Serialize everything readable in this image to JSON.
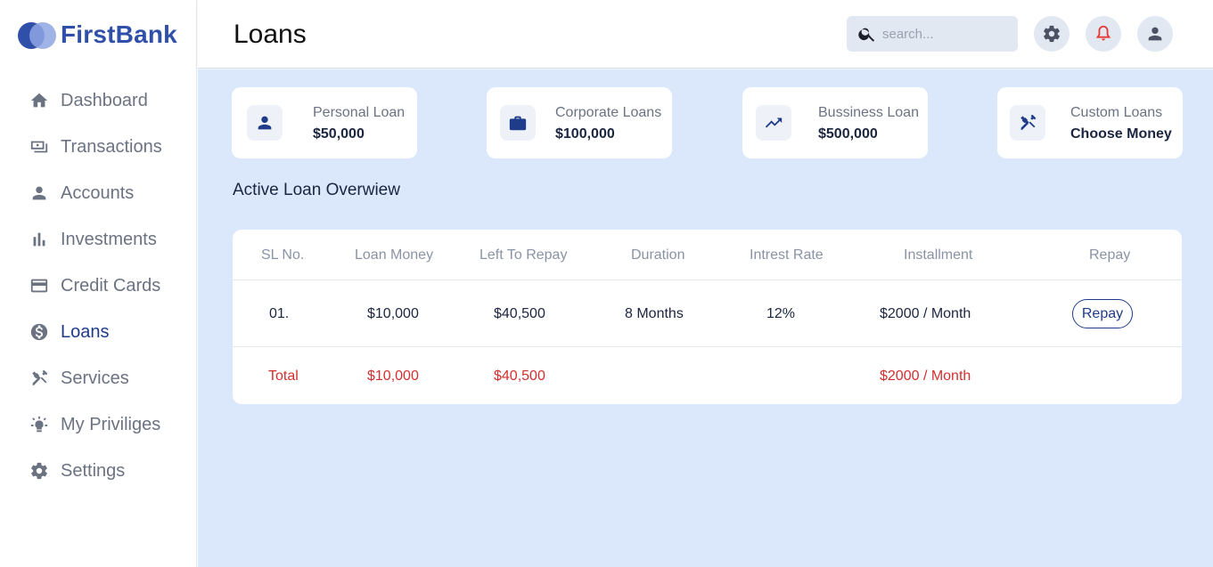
{
  "brand": {
    "name": "FirstBank",
    "primary": "#2f4fa9",
    "accent": "#8fa6e3"
  },
  "sidebar": {
    "items": [
      {
        "label": "Dashboard",
        "icon": "home-icon"
      },
      {
        "label": "Transactions",
        "icon": "money-icon"
      },
      {
        "label": "Accounts",
        "icon": "person-icon"
      },
      {
        "label": "Investments",
        "icon": "bar-chart-icon"
      },
      {
        "label": "Credit Cards",
        "icon": "credit-card-icon"
      },
      {
        "label": "Loans",
        "icon": "dollar-circle-icon",
        "active": true
      },
      {
        "label": "Services",
        "icon": "tools-icon"
      },
      {
        "label": "My Priviliges",
        "icon": "lightbulb-icon"
      },
      {
        "label": "Settings",
        "icon": "gear-icon"
      }
    ]
  },
  "header": {
    "title": "Loans",
    "search_placeholder": "search...",
    "icons": [
      "settings-icon",
      "bell-icon",
      "user-icon"
    ],
    "bell_color": "#e53935"
  },
  "cards": [
    {
      "title": "Personal Loan",
      "value": "$50,000",
      "icon": "person-icon"
    },
    {
      "title": "Corporate Loans",
      "value": "$100,000",
      "icon": "briefcase-icon"
    },
    {
      "title": "Bussiness Loan",
      "value": "$500,000",
      "icon": "trending-up-icon"
    },
    {
      "title": "Custom Loans",
      "value": "Choose Money",
      "icon": "tools-icon"
    }
  ],
  "overview": {
    "title": "Active Loan Overwiew",
    "columns": [
      "SL No.",
      "Loan Money",
      "Left To Repay",
      "Duration",
      "Intrest Rate",
      "Installment",
      "Repay"
    ],
    "rows": [
      {
        "sl": "01.",
        "loan_money": "$10,000",
        "left_to_repay": "$40,500",
        "duration": "8 Months",
        "rate": "12%",
        "installment": "$2000 / Month",
        "repay_label": "Repay"
      }
    ],
    "total": {
      "label": "Total",
      "loan_money": "$10,000",
      "left_to_repay": "$40,500",
      "installment": "$2000 / Month",
      "color": "#d32f2f"
    }
  }
}
